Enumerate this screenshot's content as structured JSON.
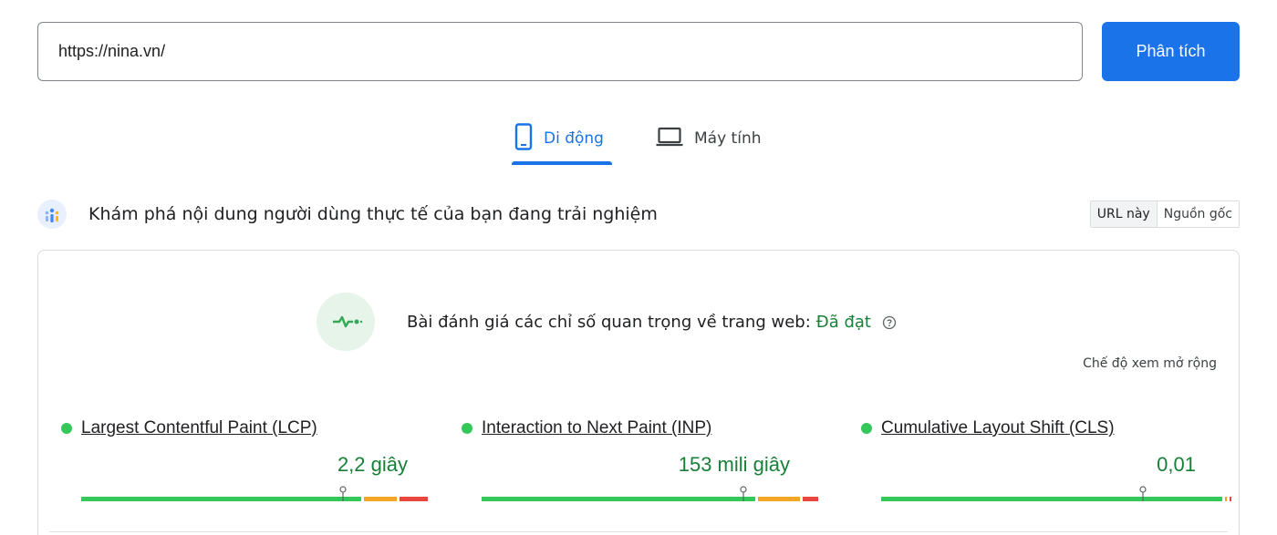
{
  "search": {
    "url_value": "https://nina.vn/",
    "analyze_label": "Phân tích"
  },
  "tabs": [
    {
      "label": "Di động",
      "icon": "phone-icon",
      "active": true
    },
    {
      "label": "Máy tính",
      "icon": "laptop-icon",
      "active": false
    }
  ],
  "crux": {
    "title": "Khám phá nội dung người dùng thực tế của bạn đang trải nghiệm",
    "toggle": {
      "this_url": "URL này",
      "origin": "Nguồn gốc"
    }
  },
  "assessment": {
    "label": "Bài đánh giá các chỉ số quan trọng về trang web:",
    "status": "Đã đạt",
    "expand_link": "Chế độ xem mở rộng"
  },
  "metrics": [
    {
      "name": "Largest Contentful Paint (LCP)",
      "value": "2,2 giây",
      "rating": "good",
      "distribution": {
        "good": 0.81,
        "needs_improvement": 0.1,
        "poor": 0.09
      },
      "marker_percentile": 0.75
    },
    {
      "name": "Interaction to Next Paint (INP)",
      "value": "153 mili giây",
      "rating": "good",
      "distribution": {
        "good": 0.79,
        "needs_improvement": 0.13,
        "poor": 0.05
      },
      "marker_percentile": 0.75
    },
    {
      "name": "Cumulative Layout Shift (CLS)",
      "value": "0,01",
      "rating": "good",
      "distribution": {
        "good": 0.985,
        "needs_improvement": 0.01,
        "poor": 0.005
      },
      "marker_percentile": 0.75
    }
  ],
  "colors": {
    "accent": "#1a73e8",
    "good": "#34c759",
    "needs_improvement": "#f4a628",
    "poor": "#e8453c",
    "pass_text": "#188038"
  }
}
